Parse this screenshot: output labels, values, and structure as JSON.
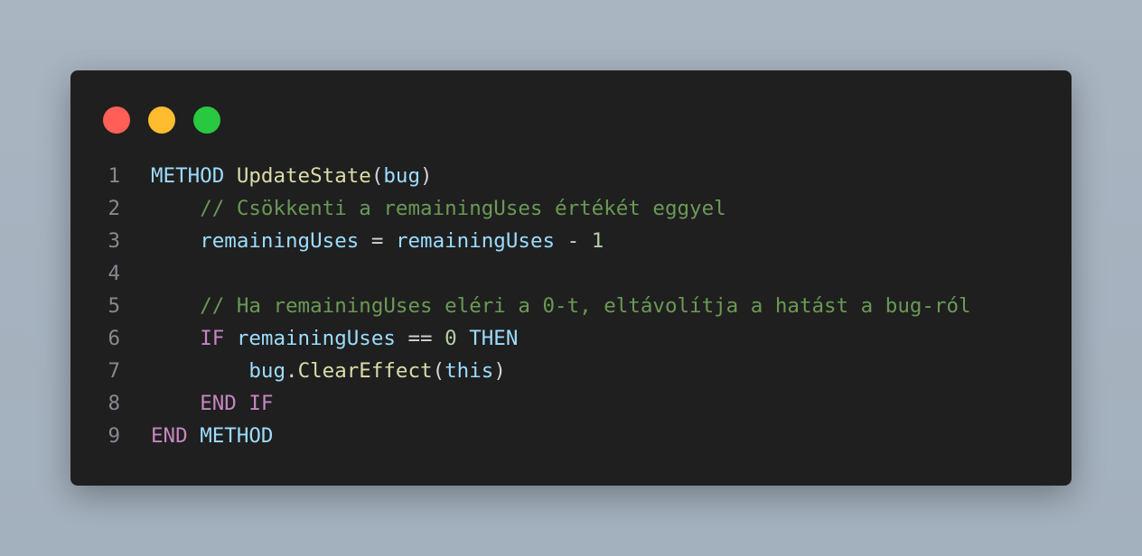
{
  "window": {
    "traffic_lights": [
      {
        "name": "close",
        "color": "#ff5f57"
      },
      {
        "name": "minimize",
        "color": "#febc2e"
      },
      {
        "name": "zoom",
        "color": "#28c840"
      }
    ]
  },
  "colors": {
    "background": "#a9b5c1",
    "editor": "#1f1f1f",
    "line_number": "#858a91",
    "keyword_method": "#9cdcfe",
    "keyword_control": "#c586c0",
    "function": "#dcdcaa",
    "variable": "#9cdcfe",
    "number": "#b5cea8",
    "comment": "#6a9955"
  },
  "code": {
    "lines": [
      {
        "number": "1",
        "indent": "",
        "tokens": [
          {
            "text": "METHOD",
            "kind": "kw"
          },
          {
            "text": " ",
            "kind": "op"
          },
          {
            "text": "UpdateState",
            "kind": "fn"
          },
          {
            "text": "(",
            "kind": "op"
          },
          {
            "text": "bug",
            "kind": "vr"
          },
          {
            "text": ")",
            "kind": "op"
          }
        ]
      },
      {
        "number": "2",
        "indent": "    ",
        "tokens": [
          {
            "text": "// Csökkenti a remainingUses értékét eggyel",
            "kind": "cm"
          }
        ]
      },
      {
        "number": "3",
        "indent": "    ",
        "tokens": [
          {
            "text": "remainingUses",
            "kind": "vr"
          },
          {
            "text": " = ",
            "kind": "op"
          },
          {
            "text": "remainingUses",
            "kind": "vr"
          },
          {
            "text": " - ",
            "kind": "op"
          },
          {
            "text": "1",
            "kind": "num"
          }
        ]
      },
      {
        "number": "4",
        "indent": "",
        "tokens": []
      },
      {
        "number": "5",
        "indent": "    ",
        "tokens": [
          {
            "text": "// Ha remainingUses eléri a 0-t, eltávolítja a hatást a bug-ról",
            "kind": "cm"
          }
        ]
      },
      {
        "number": "6",
        "indent": "    ",
        "tokens": [
          {
            "text": "IF",
            "kind": "kw2"
          },
          {
            "text": " ",
            "kind": "op"
          },
          {
            "text": "remainingUses",
            "kind": "vr"
          },
          {
            "text": " == ",
            "kind": "op"
          },
          {
            "text": "0",
            "kind": "num"
          },
          {
            "text": " ",
            "kind": "op"
          },
          {
            "text": "THEN",
            "kind": "kw"
          }
        ]
      },
      {
        "number": "7",
        "indent": "        ",
        "tokens": [
          {
            "text": "bug",
            "kind": "vr"
          },
          {
            "text": ".",
            "kind": "op"
          },
          {
            "text": "ClearEffect",
            "kind": "fn"
          },
          {
            "text": "(",
            "kind": "op"
          },
          {
            "text": "this",
            "kind": "vr"
          },
          {
            "text": ")",
            "kind": "op"
          }
        ]
      },
      {
        "number": "8",
        "indent": "    ",
        "tokens": [
          {
            "text": "END",
            "kind": "kw2"
          },
          {
            "text": " ",
            "kind": "op"
          },
          {
            "text": "IF",
            "kind": "kw2"
          }
        ]
      },
      {
        "number": "9",
        "indent": "",
        "tokens": [
          {
            "text": "END",
            "kind": "kw2"
          },
          {
            "text": " ",
            "kind": "op"
          },
          {
            "text": "METHOD",
            "kind": "kw"
          }
        ]
      }
    ]
  }
}
